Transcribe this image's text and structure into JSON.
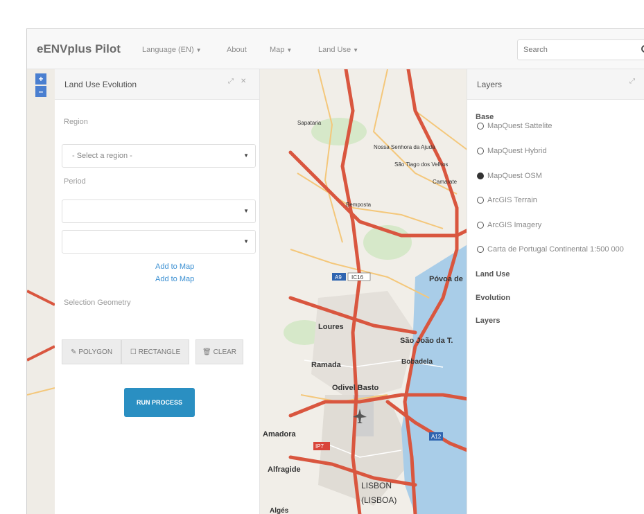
{
  "navbar": {
    "brand": "eENVplus Pilot",
    "items": [
      {
        "label": "Language (EN)",
        "dropdown": true
      },
      {
        "label": "About",
        "dropdown": false
      },
      {
        "label": "Map",
        "dropdown": true
      },
      {
        "label": "Land Use",
        "dropdown": true
      }
    ],
    "search_placeholder": "Search"
  },
  "map": {
    "zoom_in": "+",
    "zoom_out": "–",
    "labels": [
      "Sapataria",
      "Nossa Senhora da Ajuda",
      "São Tiago dos Velhos",
      "Bemposta",
      "Camarate",
      "A9",
      "IC16",
      "Póvoa de",
      "Loures",
      "São João da T.",
      "Ramada",
      "Bobadela",
      "Odivel Basto",
      "Amadora",
      "IP7",
      "Alfragide",
      "LISBON",
      "(LISBOA)",
      "Algés",
      "A12"
    ]
  },
  "left_panel": {
    "title": "Land Use Evolution",
    "region_label": "Region",
    "region_value": "- Select a region -",
    "period_label": "Period",
    "period_value_1": "",
    "period_value_2": "",
    "add_link_1": "Add to Map",
    "add_link_2": "Add to Map",
    "geometry_label": "Selection Geometry",
    "polygon_btn": "POLYGON",
    "rectangle_btn": "RECTANGLE",
    "clear_btn": "CLEAR",
    "run_btn": "RUN PROCESS"
  },
  "right_panel": {
    "title": "Layers",
    "base_label": "Base",
    "base_options": [
      {
        "label": "MapQuest Sattelite",
        "checked": false
      },
      {
        "label": "MapQuest Hybrid",
        "checked": false
      },
      {
        "label": "MapQuest OSM",
        "checked": true
      },
      {
        "label": "ArcGIS Terrain",
        "checked": false
      },
      {
        "label": "ArcGIS Imagery",
        "checked": false
      },
      {
        "label": "Carta de Portugal Continental 1:500 000",
        "checked": false
      }
    ],
    "land_use_label": "Land Use",
    "evolution_label": "Evolution",
    "layers_label": "Layers"
  },
  "colors": {
    "accent": "#2a8fc2",
    "link": "#3a8fd2",
    "motorway": "#d9563f",
    "water": "#a9cde8",
    "land": "#f2efe9"
  }
}
